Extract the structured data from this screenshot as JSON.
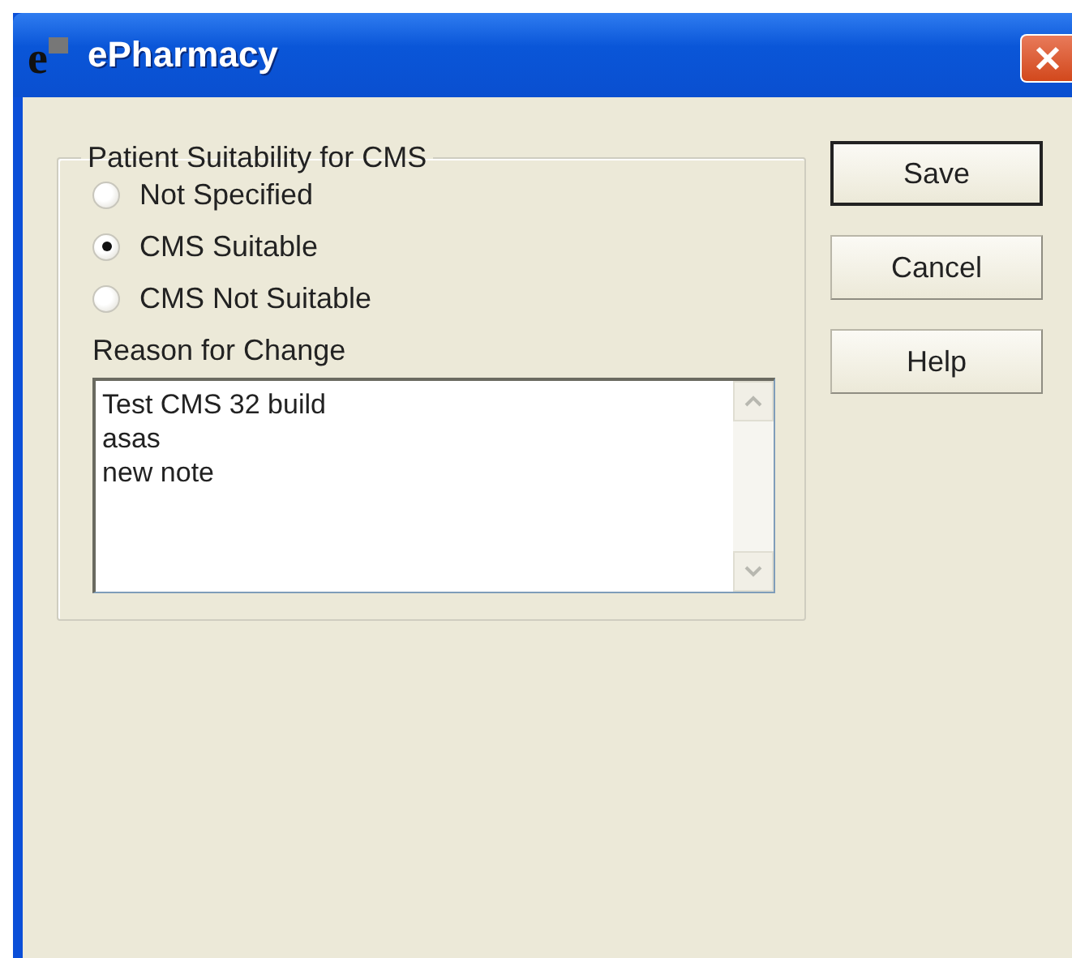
{
  "window": {
    "logo": "e",
    "title": "ePharmacy"
  },
  "suitability_group": {
    "title": "Patient Suitability for CMS",
    "options": [
      {
        "label": "Not Specified",
        "selected": false
      },
      {
        "label": "CMS Suitable",
        "selected": true
      },
      {
        "label": "CMS Not Suitable",
        "selected": false
      }
    ]
  },
  "reason": {
    "label": "Reason for Change",
    "value": "Test CMS 32 build\nasas\nnew note"
  },
  "buttons": [
    {
      "label": "Save",
      "default": true
    },
    {
      "label": "Cancel",
      "default": false
    },
    {
      "label": "Help",
      "default": false
    }
  ]
}
